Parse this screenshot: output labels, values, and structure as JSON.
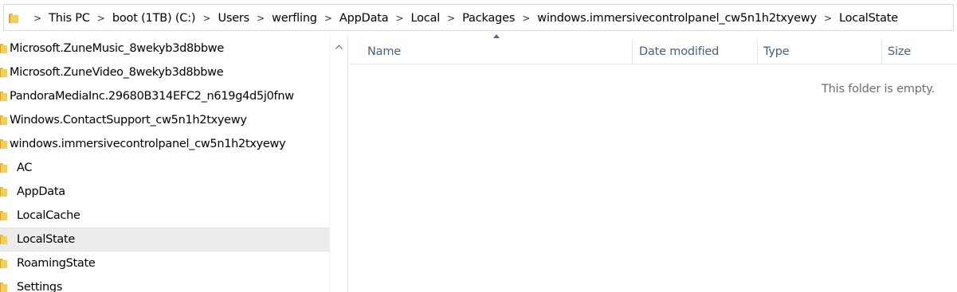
{
  "address_bar": {
    "crumbs": [
      "This PC",
      "boot (1TB) (C:)",
      "Users",
      "werfling",
      "AppData",
      "Local",
      "Packages",
      "windows.immersivecontrolpanel_cw5n1h2txyewy",
      "LocalState"
    ],
    "separator": ">"
  },
  "nav_pane": {
    "items": [
      {
        "label": "Microsoft.ZuneMusic_8wekyb3d8bbwe"
      },
      {
        "label": "Microsoft.ZuneVideo_8wekyb3d8bbwe"
      },
      {
        "label": "PandoraMediaInc.29680B314EFC2_n619g4d5j0fnw"
      },
      {
        "label": "Windows.ContactSupport_cw5n1h2txyewy"
      },
      {
        "label": "windows.immersivecontrolpanel_cw5n1h2txyewy"
      },
      {
        "label": "AC"
      },
      {
        "label": "AppData"
      },
      {
        "label": "LocalCache"
      },
      {
        "label": "LocalState",
        "selected": true
      },
      {
        "label": "RoamingState"
      },
      {
        "label": "Settings"
      }
    ]
  },
  "file_list": {
    "columns": [
      "Name",
      "Date modified",
      "Type",
      "Size"
    ],
    "empty_message": "This folder is empty."
  },
  "colors": {
    "folder": "#f3cd5d",
    "header_text": "#4c607a",
    "selection": "#ececec"
  }
}
